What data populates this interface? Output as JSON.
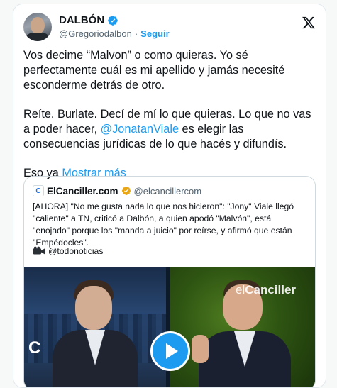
{
  "tweet": {
    "author": {
      "name": "DALBÓN",
      "handle": "@Gregoriodalbon",
      "separator": "·",
      "follow_label": "Seguir"
    },
    "paragraph1": "Vos decime “Malvon” o como quieras. Yo sé perfectamente cuál es mi apellido y jamás necesité esconderme detrás de otro.",
    "paragraph2_before": "Reíte. Burlate. Decí de mí lo que quieras. Lo que no vas a poder hacer, ",
    "paragraph2_mention": "@JonatanViale",
    "paragraph2_after": " es elegir las consecuencias jurídicas de lo que hacés y difundís.",
    "paragraph3": "Eso ya",
    "show_more": "Mostrar más"
  },
  "quote": {
    "logo_letter": "C",
    "name": "ElCanciller.com",
    "handle": "@elcancillercom",
    "text": "[AHORA] \"No me gusta nada lo que nos hicieron\": \"Jony\" Viale llegó \"caliente\" a TN, criticó a Dalbón, a quien apodó \"Malvón\", está \"enojado\" porque los \"manda a juicio\" por reírse, y afirmó que están \"Empédocles\".",
    "source": "@todonoticias",
    "media": {
      "watermark_a": "el",
      "watermark_b": "Canciller",
      "corner_letter": "C"
    }
  },
  "icons": [
    "verified-badge-icon",
    "x-logo-icon",
    "camera-icon",
    "play-icon"
  ],
  "colors": {
    "accent": "#1d9bf0",
    "verified_gold": "#e8a514",
    "text": "#0f1419",
    "muted": "#536471"
  }
}
